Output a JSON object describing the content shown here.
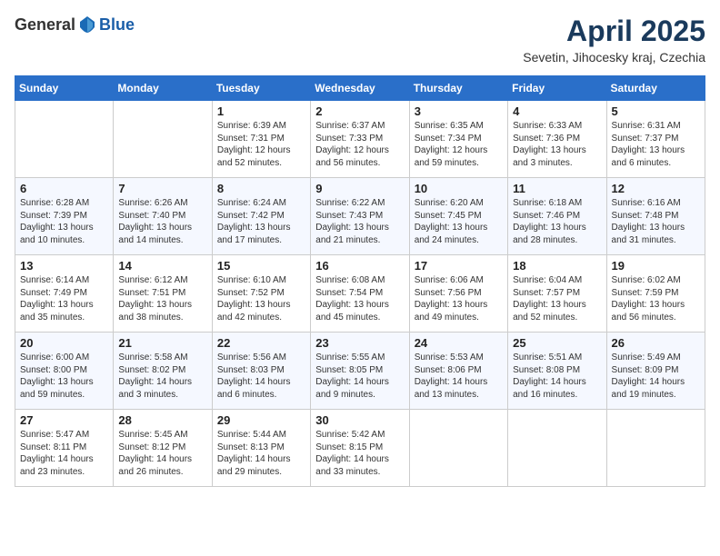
{
  "header": {
    "logo_general": "General",
    "logo_blue": "Blue",
    "month_title": "April 2025",
    "location": "Sevetin, Jihocesky kraj, Czechia"
  },
  "days_of_week": [
    "Sunday",
    "Monday",
    "Tuesday",
    "Wednesday",
    "Thursday",
    "Friday",
    "Saturday"
  ],
  "weeks": [
    [
      {
        "day": "",
        "sunrise": "",
        "sunset": "",
        "daylight": ""
      },
      {
        "day": "",
        "sunrise": "",
        "sunset": "",
        "daylight": ""
      },
      {
        "day": "1",
        "sunrise": "Sunrise: 6:39 AM",
        "sunset": "Sunset: 7:31 PM",
        "daylight": "Daylight: 12 hours and 52 minutes."
      },
      {
        "day": "2",
        "sunrise": "Sunrise: 6:37 AM",
        "sunset": "Sunset: 7:33 PM",
        "daylight": "Daylight: 12 hours and 56 minutes."
      },
      {
        "day": "3",
        "sunrise": "Sunrise: 6:35 AM",
        "sunset": "Sunset: 7:34 PM",
        "daylight": "Daylight: 12 hours and 59 minutes."
      },
      {
        "day": "4",
        "sunrise": "Sunrise: 6:33 AM",
        "sunset": "Sunset: 7:36 PM",
        "daylight": "Daylight: 13 hours and 3 minutes."
      },
      {
        "day": "5",
        "sunrise": "Sunrise: 6:31 AM",
        "sunset": "Sunset: 7:37 PM",
        "daylight": "Daylight: 13 hours and 6 minutes."
      }
    ],
    [
      {
        "day": "6",
        "sunrise": "Sunrise: 6:28 AM",
        "sunset": "Sunset: 7:39 PM",
        "daylight": "Daylight: 13 hours and 10 minutes."
      },
      {
        "day": "7",
        "sunrise": "Sunrise: 6:26 AM",
        "sunset": "Sunset: 7:40 PM",
        "daylight": "Daylight: 13 hours and 14 minutes."
      },
      {
        "day": "8",
        "sunrise": "Sunrise: 6:24 AM",
        "sunset": "Sunset: 7:42 PM",
        "daylight": "Daylight: 13 hours and 17 minutes."
      },
      {
        "day": "9",
        "sunrise": "Sunrise: 6:22 AM",
        "sunset": "Sunset: 7:43 PM",
        "daylight": "Daylight: 13 hours and 21 minutes."
      },
      {
        "day": "10",
        "sunrise": "Sunrise: 6:20 AM",
        "sunset": "Sunset: 7:45 PM",
        "daylight": "Daylight: 13 hours and 24 minutes."
      },
      {
        "day": "11",
        "sunrise": "Sunrise: 6:18 AM",
        "sunset": "Sunset: 7:46 PM",
        "daylight": "Daylight: 13 hours and 28 minutes."
      },
      {
        "day": "12",
        "sunrise": "Sunrise: 6:16 AM",
        "sunset": "Sunset: 7:48 PM",
        "daylight": "Daylight: 13 hours and 31 minutes."
      }
    ],
    [
      {
        "day": "13",
        "sunrise": "Sunrise: 6:14 AM",
        "sunset": "Sunset: 7:49 PM",
        "daylight": "Daylight: 13 hours and 35 minutes."
      },
      {
        "day": "14",
        "sunrise": "Sunrise: 6:12 AM",
        "sunset": "Sunset: 7:51 PM",
        "daylight": "Daylight: 13 hours and 38 minutes."
      },
      {
        "day": "15",
        "sunrise": "Sunrise: 6:10 AM",
        "sunset": "Sunset: 7:52 PM",
        "daylight": "Daylight: 13 hours and 42 minutes."
      },
      {
        "day": "16",
        "sunrise": "Sunrise: 6:08 AM",
        "sunset": "Sunset: 7:54 PM",
        "daylight": "Daylight: 13 hours and 45 minutes."
      },
      {
        "day": "17",
        "sunrise": "Sunrise: 6:06 AM",
        "sunset": "Sunset: 7:56 PM",
        "daylight": "Daylight: 13 hours and 49 minutes."
      },
      {
        "day": "18",
        "sunrise": "Sunrise: 6:04 AM",
        "sunset": "Sunset: 7:57 PM",
        "daylight": "Daylight: 13 hours and 52 minutes."
      },
      {
        "day": "19",
        "sunrise": "Sunrise: 6:02 AM",
        "sunset": "Sunset: 7:59 PM",
        "daylight": "Daylight: 13 hours and 56 minutes."
      }
    ],
    [
      {
        "day": "20",
        "sunrise": "Sunrise: 6:00 AM",
        "sunset": "Sunset: 8:00 PM",
        "daylight": "Daylight: 13 hours and 59 minutes."
      },
      {
        "day": "21",
        "sunrise": "Sunrise: 5:58 AM",
        "sunset": "Sunset: 8:02 PM",
        "daylight": "Daylight: 14 hours and 3 minutes."
      },
      {
        "day": "22",
        "sunrise": "Sunrise: 5:56 AM",
        "sunset": "Sunset: 8:03 PM",
        "daylight": "Daylight: 14 hours and 6 minutes."
      },
      {
        "day": "23",
        "sunrise": "Sunrise: 5:55 AM",
        "sunset": "Sunset: 8:05 PM",
        "daylight": "Daylight: 14 hours and 9 minutes."
      },
      {
        "day": "24",
        "sunrise": "Sunrise: 5:53 AM",
        "sunset": "Sunset: 8:06 PM",
        "daylight": "Daylight: 14 hours and 13 minutes."
      },
      {
        "day": "25",
        "sunrise": "Sunrise: 5:51 AM",
        "sunset": "Sunset: 8:08 PM",
        "daylight": "Daylight: 14 hours and 16 minutes."
      },
      {
        "day": "26",
        "sunrise": "Sunrise: 5:49 AM",
        "sunset": "Sunset: 8:09 PM",
        "daylight": "Daylight: 14 hours and 19 minutes."
      }
    ],
    [
      {
        "day": "27",
        "sunrise": "Sunrise: 5:47 AM",
        "sunset": "Sunset: 8:11 PM",
        "daylight": "Daylight: 14 hours and 23 minutes."
      },
      {
        "day": "28",
        "sunrise": "Sunrise: 5:45 AM",
        "sunset": "Sunset: 8:12 PM",
        "daylight": "Daylight: 14 hours and 26 minutes."
      },
      {
        "day": "29",
        "sunrise": "Sunrise: 5:44 AM",
        "sunset": "Sunset: 8:13 PM",
        "daylight": "Daylight: 14 hours and 29 minutes."
      },
      {
        "day": "30",
        "sunrise": "Sunrise: 5:42 AM",
        "sunset": "Sunset: 8:15 PM",
        "daylight": "Daylight: 14 hours and 33 minutes."
      },
      {
        "day": "",
        "sunrise": "",
        "sunset": "",
        "daylight": ""
      },
      {
        "day": "",
        "sunrise": "",
        "sunset": "",
        "daylight": ""
      },
      {
        "day": "",
        "sunrise": "",
        "sunset": "",
        "daylight": ""
      }
    ]
  ]
}
